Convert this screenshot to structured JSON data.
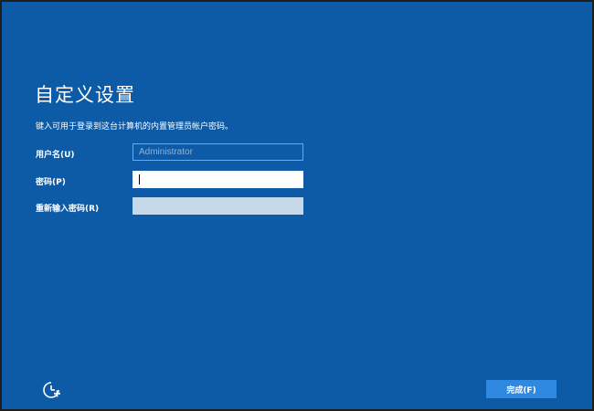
{
  "page": {
    "title": "自定义设置",
    "subtitle": "键入可用于登录到这台计算机的内置管理员帐户密码。"
  },
  "form": {
    "username_label": "用户名(U)",
    "username_placeholder": "Administrator",
    "password_label": "密码(P)",
    "password_value": "",
    "repassword_label": "重新输入密码(R)",
    "repassword_value": ""
  },
  "footer": {
    "accessibility_icon": "accessibility-icon",
    "finish_label": "完成(F)"
  },
  "colors": {
    "background": "#0d5ba6",
    "button": "#2f89e0",
    "text": "#ffffff"
  }
}
